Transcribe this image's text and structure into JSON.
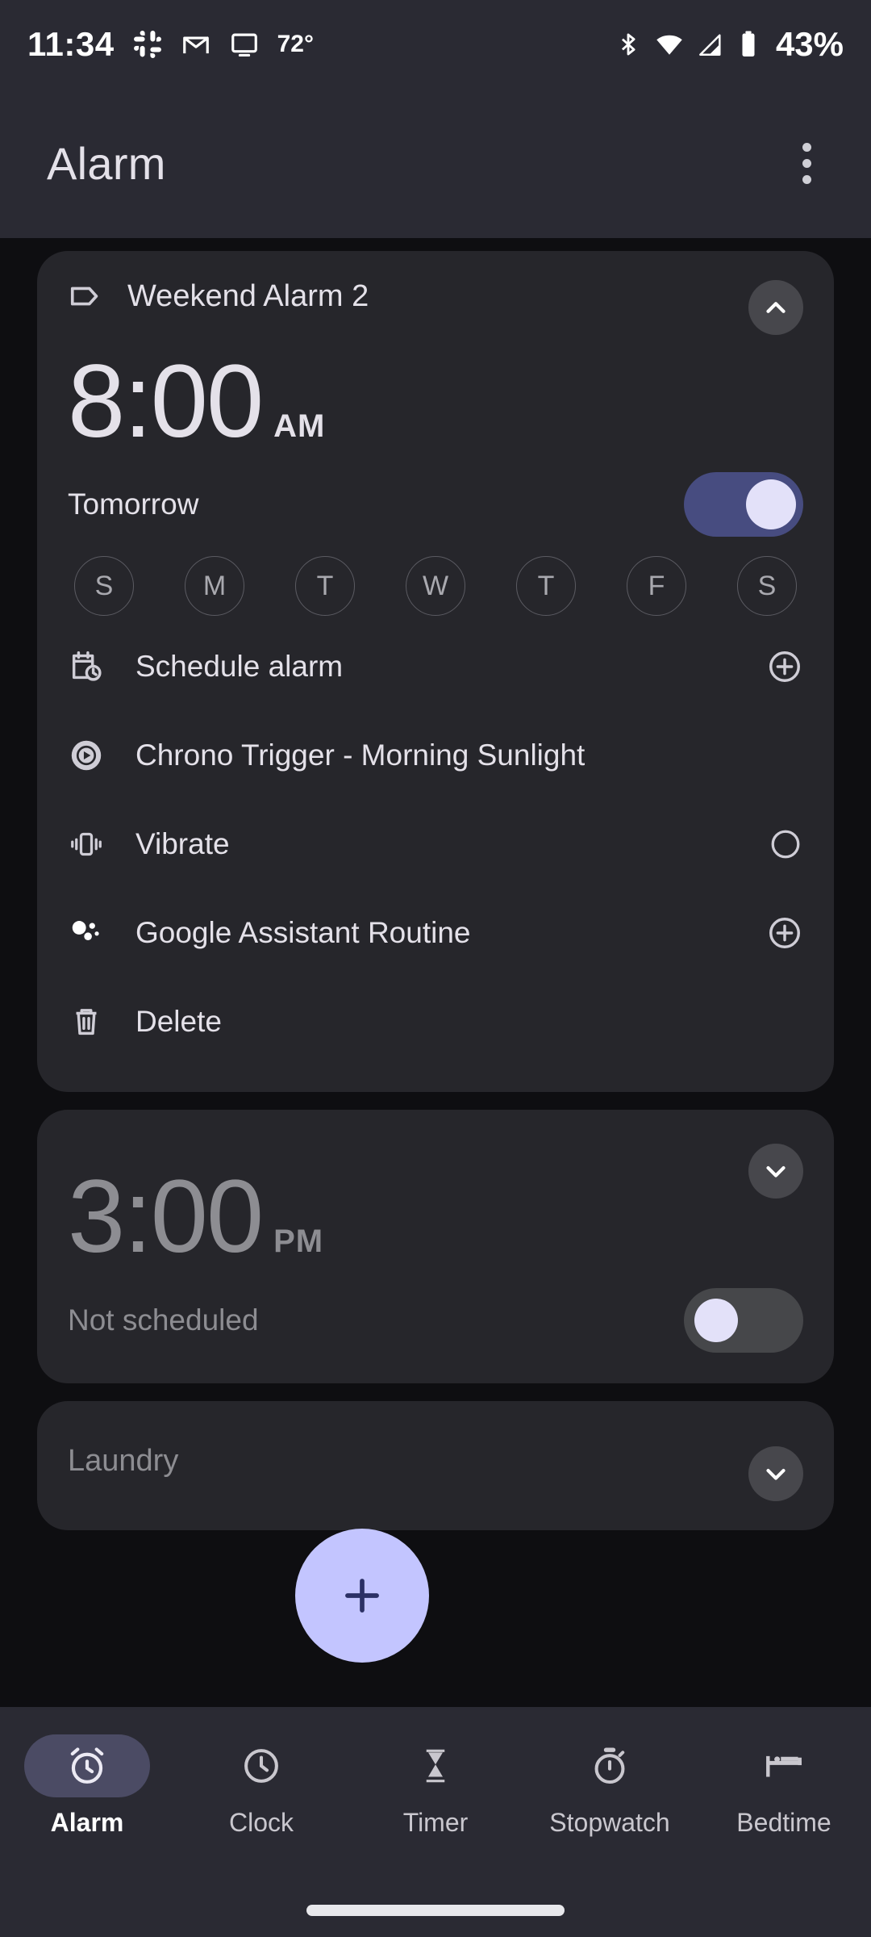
{
  "status_bar": {
    "time": "11:34",
    "temperature": "72°",
    "battery_percent": "43%",
    "icons": [
      "slack-icon",
      "gmail-icon",
      "cast-screen-icon",
      "bluetooth-icon",
      "wifi-icon",
      "cellular-signal-icon",
      "battery-icon"
    ]
  },
  "app_bar": {
    "title": "Alarm",
    "overflow_menu": "more-options-icon"
  },
  "alarms": [
    {
      "label": "Weekend Alarm 2",
      "time": "8:00",
      "ampm": "AM",
      "schedule_text": "Tomorrow",
      "enabled": true,
      "expanded": true,
      "expand_icon": "chevron-up-icon",
      "days": [
        {
          "letter": "S",
          "selected": false
        },
        {
          "letter": "M",
          "selected": false
        },
        {
          "letter": "T",
          "selected": false
        },
        {
          "letter": "W",
          "selected": false
        },
        {
          "letter": "T",
          "selected": false
        },
        {
          "letter": "F",
          "selected": false
        },
        {
          "letter": "S",
          "selected": false
        }
      ],
      "options": [
        {
          "icon": "calendar-clock-icon",
          "label": "Schedule alarm",
          "action_icon": "plus-circle-icon"
        },
        {
          "icon": "ringtone-play-icon",
          "label": "Chrono Trigger - Morning Sunlight",
          "action_icon": ""
        },
        {
          "icon": "vibrate-icon",
          "label": "Vibrate",
          "action_icon": "circle-unchecked-icon"
        },
        {
          "icon": "google-assistant-icon",
          "label": "Google Assistant Routine",
          "action_icon": "plus-circle-icon"
        },
        {
          "icon": "trash-icon",
          "label": "Delete",
          "action_icon": ""
        }
      ]
    },
    {
      "label": "",
      "time": "3:00",
      "ampm": "PM",
      "schedule_text": "Not scheduled",
      "enabled": false,
      "expanded": false,
      "expand_icon": "chevron-down-icon"
    },
    {
      "label": "Laundry",
      "expand_icon": "chevron-down-icon"
    }
  ],
  "fab": {
    "icon": "plus-icon",
    "label": "Add alarm"
  },
  "bottom_nav": {
    "items": [
      {
        "label": "Alarm",
        "icon": "alarm-clock-icon",
        "active": true
      },
      {
        "label": "Clock",
        "icon": "clock-icon",
        "active": false
      },
      {
        "label": "Timer",
        "icon": "hourglass-icon",
        "active": false
      },
      {
        "label": "Stopwatch",
        "icon": "stopwatch-icon",
        "active": false
      },
      {
        "label": "Bedtime",
        "icon": "bed-icon",
        "active": false
      }
    ]
  },
  "colors": {
    "background": "#0e0e11",
    "surface": "#26262b",
    "bar": "#2a2a33",
    "accent": "#c3c5ff",
    "switch_on_track": "#474c80",
    "switch_thumb": "#e3e1f9",
    "text_primary": "#e4e1e9",
    "text_disabled": "#8d8d92"
  }
}
